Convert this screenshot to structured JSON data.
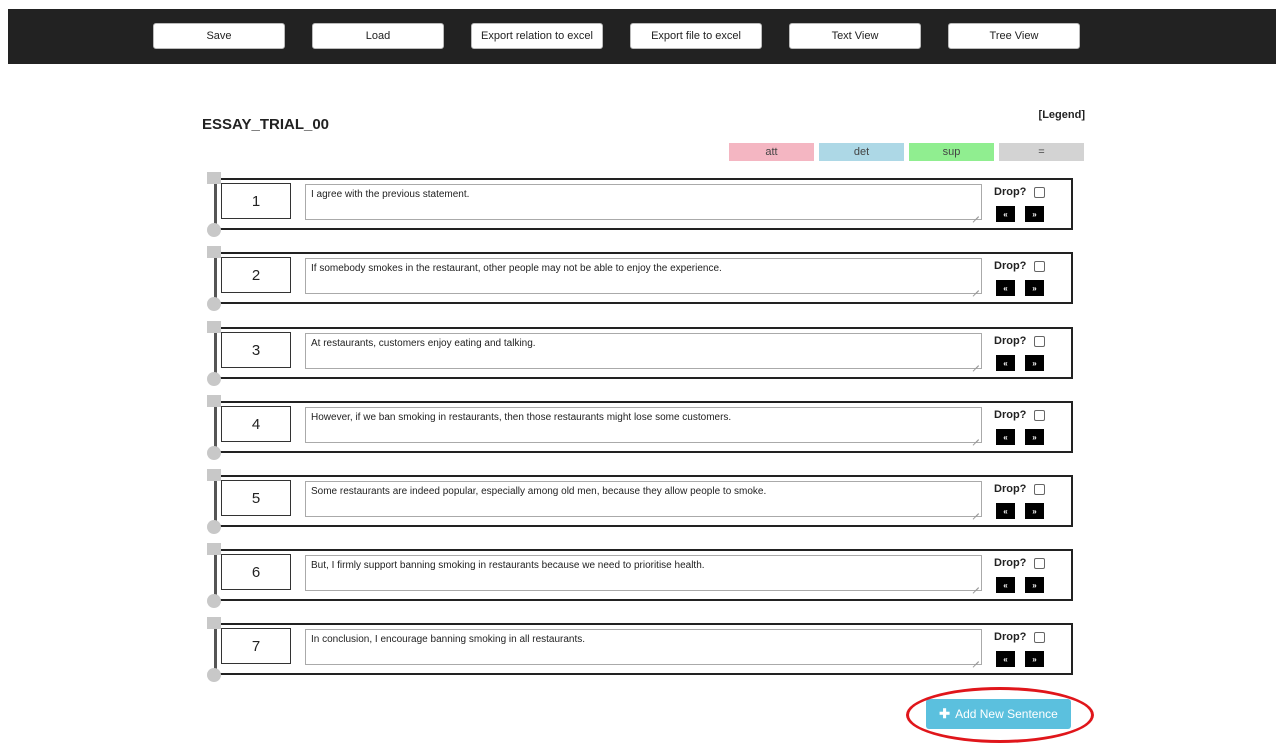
{
  "toolbar": {
    "buttons": [
      {
        "label": "Save"
      },
      {
        "label": "Load"
      },
      {
        "label": "Export relation to excel"
      },
      {
        "label": "Export file to excel"
      },
      {
        "label": "Text View"
      },
      {
        "label": "Tree View"
      }
    ]
  },
  "essay": {
    "title": "ESSAY_TRIAL_00",
    "legend_link": "[Legend]"
  },
  "legend": [
    {
      "label": "att",
      "color": "#f4b6c2"
    },
    {
      "label": "det",
      "color": "#add8e6"
    },
    {
      "label": "sup",
      "color": "#90ee90"
    },
    {
      "label": "=",
      "color": "#d3d3d3"
    }
  ],
  "sentences": [
    {
      "number": "1",
      "text": "I agree with the previous statement."
    },
    {
      "number": "2",
      "text": "If somebody smokes in the restaurant, other people may not be able to enjoy the experience."
    },
    {
      "number": "3",
      "text": "At restaurants, customers enjoy eating and talking."
    },
    {
      "number": "4",
      "text": "However, if we ban smoking in restaurants, then those restaurants might lose some customers."
    },
    {
      "number": "5",
      "text": "Some restaurants are indeed popular, especially among old men, because they allow people to smoke."
    },
    {
      "number": "6",
      "text": "But, I firmly support banning smoking in restaurants because we need to prioritise health."
    },
    {
      "number": "7",
      "text": "In conclusion, I encourage banning smoking in all restaurants."
    }
  ],
  "row_controls": {
    "drop_label": "Drop?",
    "move_left": "«",
    "move_right": "»"
  },
  "add_button": {
    "icon": "plus-icon",
    "label": "Add New Sentence"
  }
}
